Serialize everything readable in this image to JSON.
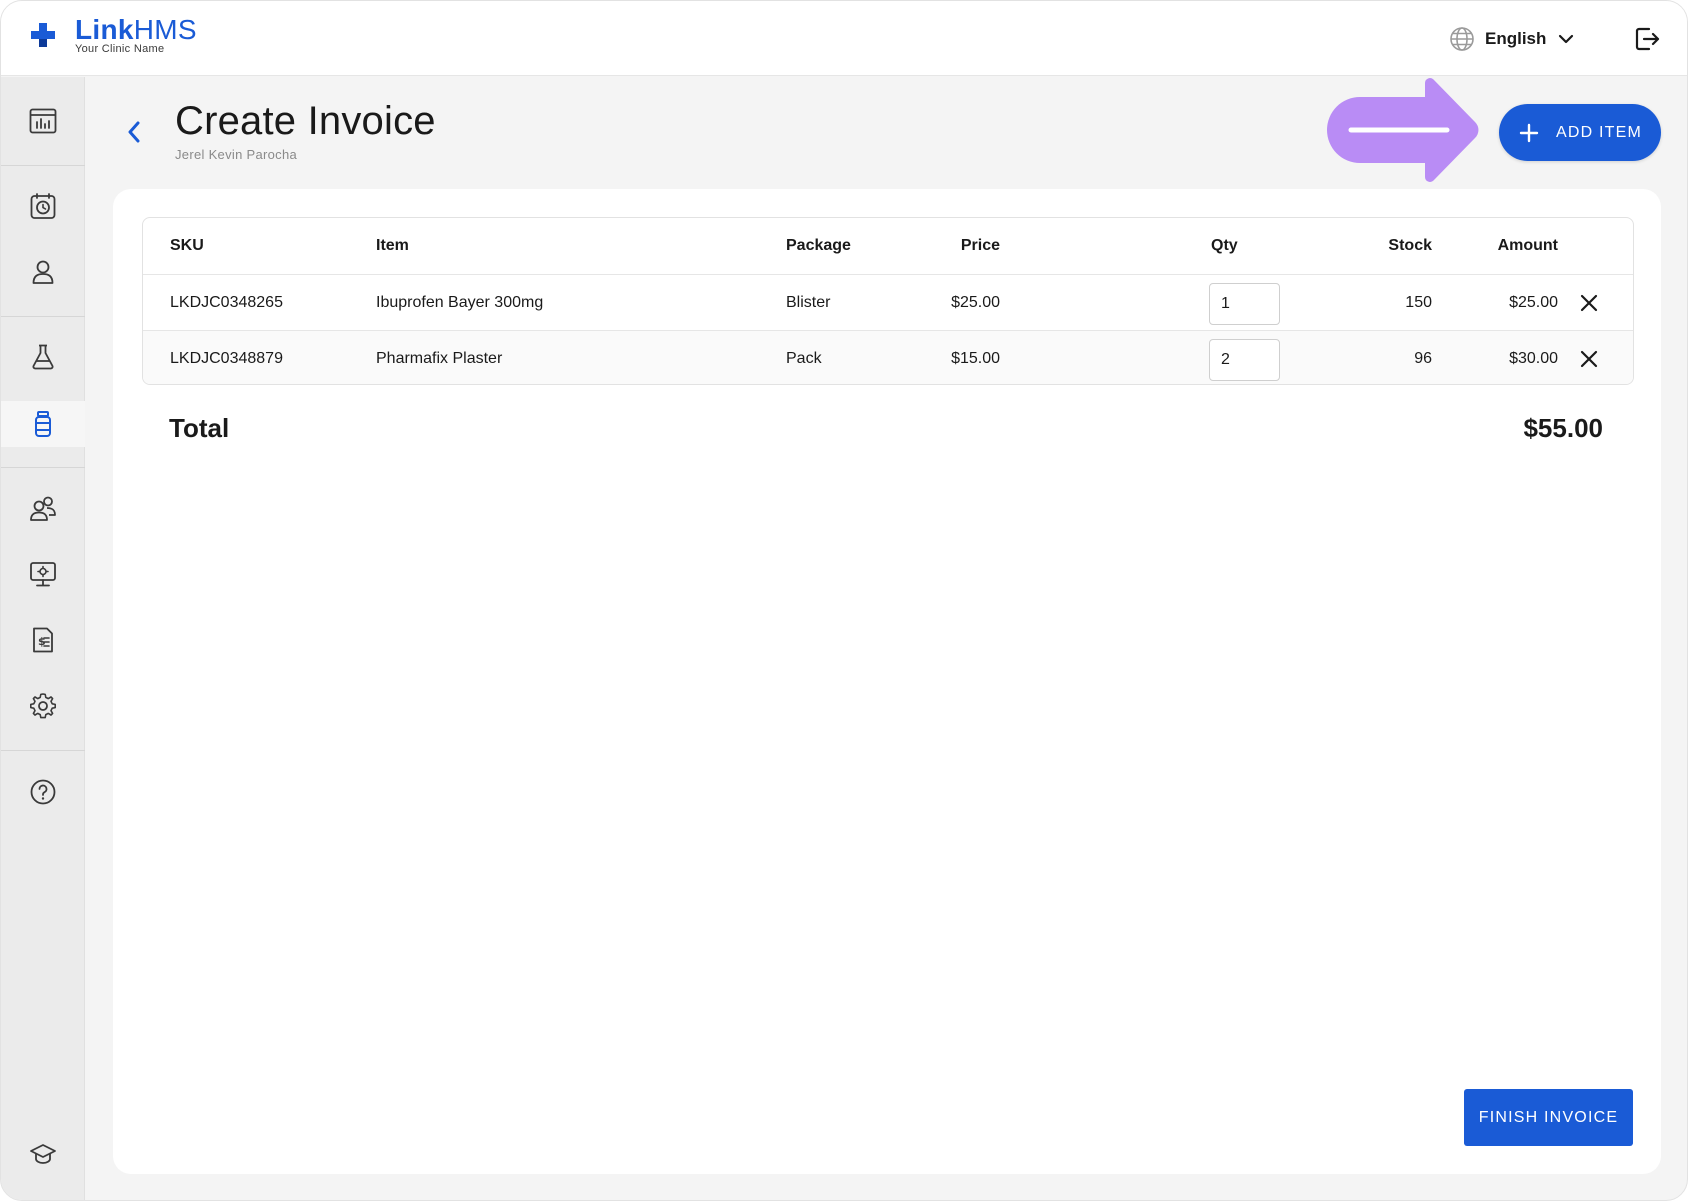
{
  "brand": {
    "name_main": "Link",
    "name_rest": "HMS",
    "subtitle": "Your Clinic Name",
    "color": "#1a5bd6"
  },
  "header": {
    "language": "English"
  },
  "sidebar": {
    "items": [
      {
        "icon": "dashboard-chart-icon",
        "active": false
      },
      {
        "icon": "appointments-clock-icon",
        "active": false
      },
      {
        "icon": "patient-user-icon",
        "active": false
      },
      {
        "icon": "lab-flask-icon",
        "active": false
      },
      {
        "icon": "pharmacy-bottle-icon",
        "active": true
      },
      {
        "icon": "staff-users-icon",
        "active": false
      },
      {
        "icon": "monitor-settings-icon",
        "active": false
      },
      {
        "icon": "billing-document-icon",
        "active": false
      },
      {
        "icon": "settings-gear-icon",
        "active": false
      },
      {
        "icon": "help-question-icon",
        "active": false
      },
      {
        "icon": "training-cap-icon",
        "active": false
      }
    ]
  },
  "page": {
    "title": "Create Invoice",
    "subtitle": "Jerel Kevin Parocha",
    "add_item_label": "ADD ITEM"
  },
  "table": {
    "columns": {
      "sku": "SKU",
      "item": "Item",
      "package": "Package",
      "price": "Price",
      "qty": "Qty",
      "stock": "Stock",
      "amount": "Amount"
    },
    "rows": [
      {
        "sku": "LKDJC0348265",
        "item": "Ibuprofen Bayer 300mg",
        "package": "Blister",
        "price": "$25.00",
        "qty": "1",
        "stock": "150",
        "amount": "$25.00"
      },
      {
        "sku": "LKDJC0348879",
        "item": "Pharmafix Plaster",
        "package": "Pack",
        "price": "$15.00",
        "qty": "2",
        "stock": "96",
        "amount": "$30.00"
      }
    ]
  },
  "total": {
    "label": "Total",
    "value": "$55.00"
  },
  "finish_label": "FINISH INVOICE",
  "colors": {
    "accent": "#1a5bd6",
    "annotation_arrow": "#b98cf5"
  }
}
